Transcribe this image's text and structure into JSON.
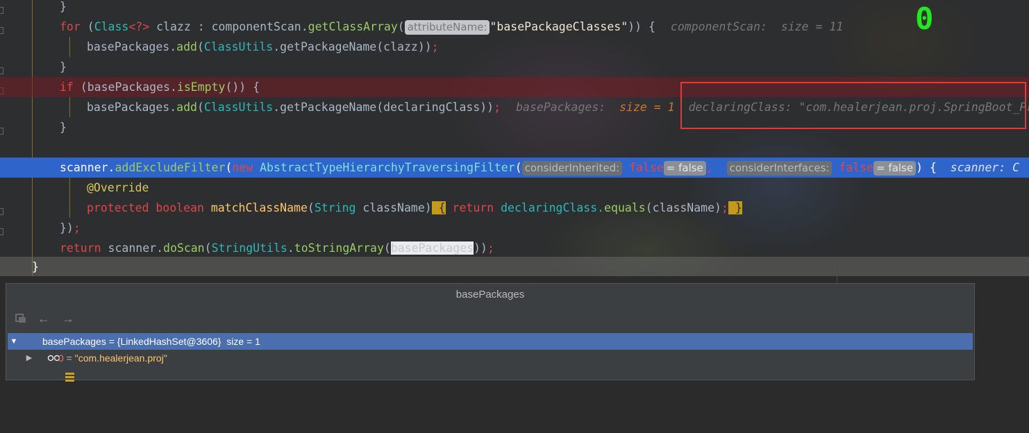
{
  "editor": {
    "lines": {
      "l1": "}",
      "l2_for": "for",
      "l2_a": " (",
      "l2_class": "Class",
      "l2_gen": "<?>",
      "l2_b": " clazz : componentScan.",
      "l2_method": "getClassArray",
      "l2_c": "(",
      "l2_hint": "attributeName:",
      "l2_str": "\"basePackageClasses\"",
      "l2_d": ")) {",
      "l2_debug": "componentScan:  size = 11",
      "l3_a": "basePackages.",
      "l3_method": "add",
      "l3_b": "(",
      "l3_cls": "ClassUtils",
      "l3_c": ".getPackageName(clazz))",
      "l3_semi": ";",
      "l4": "}",
      "l5_if": "if",
      "l5_a": " (basePackages.",
      "l5_method": "isEmpty",
      "l5_b": "()) {",
      "l6_a": "basePackages.",
      "l6_method": "add",
      "l6_b": "(",
      "l6_cls": "ClassUtils",
      "l6_c": ".getPackageName(declaringClass))",
      "l6_semi": ";",
      "l6_debug1": "basePackages:  ",
      "l6_debug1v": "size = 1",
      "l6_debug2": "declaringClass: \"com.healerjean.proj.SpringBoot_Pr",
      "l7": "}",
      "l9_a": "scanner.",
      "l9_method": "addExcludeFilter",
      "l9_b": "(",
      "l9_new": "new ",
      "l9_cls": "AbstractTypeHierarchyTraversingFilter",
      "l9_c": "(",
      "l9_hint1": "considerInherited:",
      "l9_false1": " false",
      "l9_eq1": "= false",
      "l9_comma": ",  ",
      "l9_hint2": "considerInterfaces:",
      "l9_false2": " false",
      "l9_eq2": "= false",
      "l9_d": ") {  ",
      "l9_debug": "scanner: C",
      "l10": "@Override",
      "l11_prot": "protected",
      "l11_bool": " boolean ",
      "l11_method": "matchClassName",
      "l11_a": "(",
      "l11_str": "String",
      "l11_b": " className)",
      "l11_brace1": " {",
      "l11_ret": " return ",
      "l11_c": "declaringClass.",
      "l11_eq": "equals",
      "l11_d": "(className)",
      "l11_semi": ";",
      "l11_brace2": " }",
      "l12_a": "})",
      "l12_semi": ";",
      "l13_ret": "return",
      "l13_a": " scanner.",
      "l13_method": "doScan",
      "l13_b": "(",
      "l13_cls": "StringUtils",
      "l13_c": ".",
      "l13_m2": "toStringArray",
      "l13_d": "(",
      "l13_sel": "basePackages",
      "l13_e": "))",
      "l13_semi": ";",
      "l14": "}"
    },
    "counter": "0"
  },
  "popup": {
    "title": "basePackages",
    "toolbar": {
      "icons": [
        "copy-icon",
        "back-arrow-icon",
        "forward-arrow-icon"
      ]
    },
    "tree": [
      {
        "name": "basePackages",
        "eq": " = {LinkedHashSet@3606}  ",
        "size": "size = 1",
        "expanded": true,
        "selected": true,
        "icon": "watch-glasses-icon"
      },
      {
        "index": "0",
        "eq": " = ",
        "value": "\"com.healerjean.proj\"",
        "expanded": false,
        "selected": false,
        "icon": "list-item-icon"
      }
    ]
  },
  "colors": {
    "selection_blue": "#2f65ca",
    "tree_selection": "#4b6eaf",
    "highlight_red": "#e53935",
    "counter_green": "#22e822"
  }
}
